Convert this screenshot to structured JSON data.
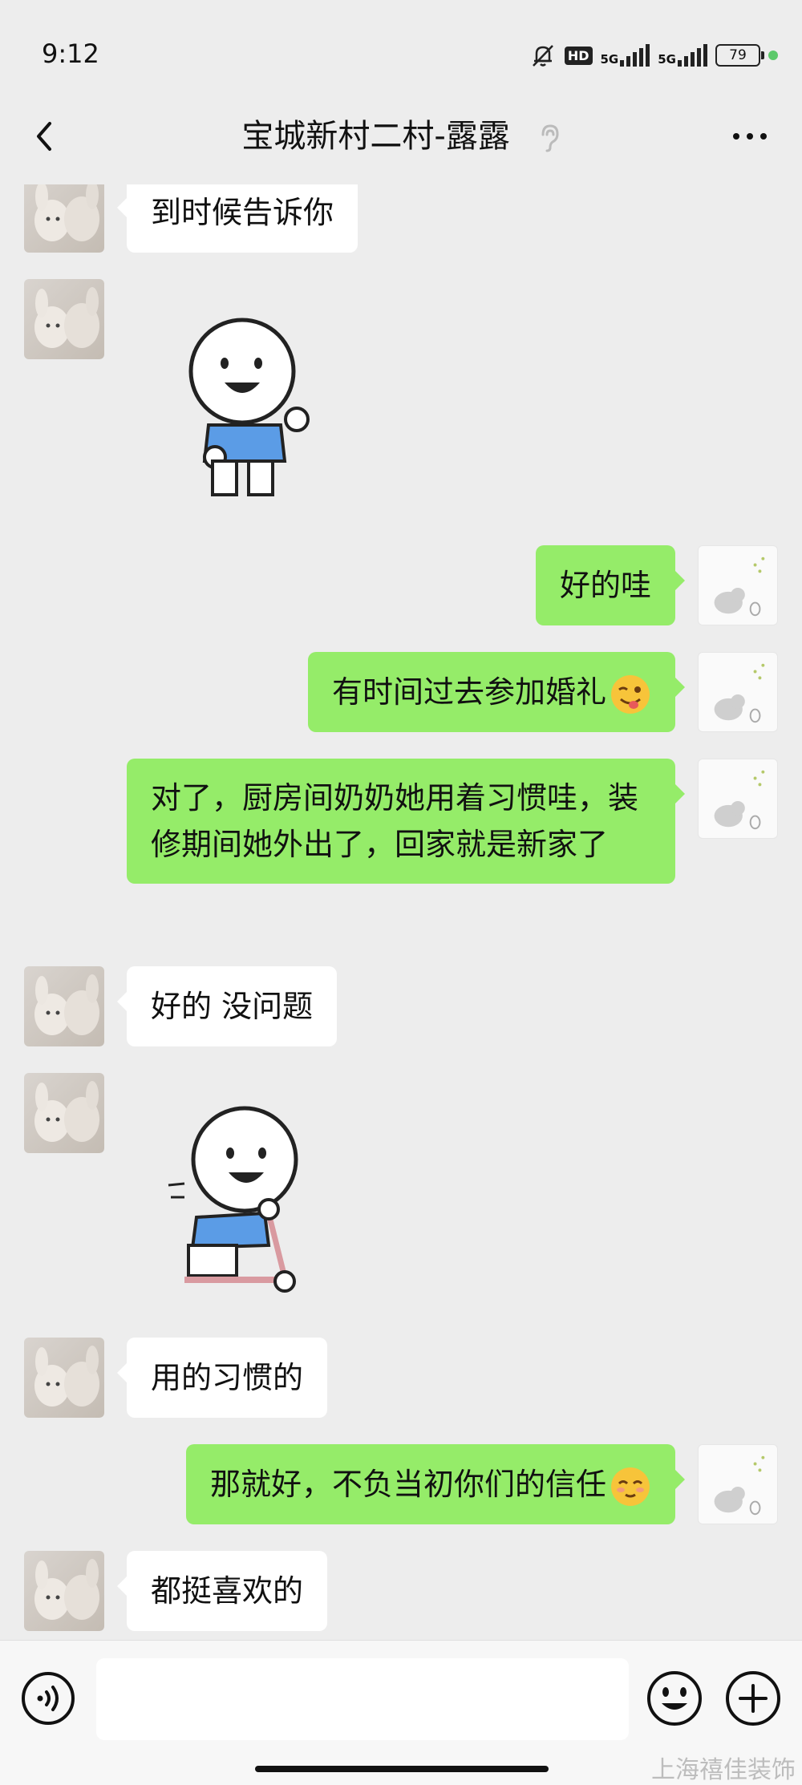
{
  "status_bar": {
    "time": "9:12",
    "hd_label": "HD",
    "network_a": "5G",
    "network_b": "5G",
    "battery": "79"
  },
  "header": {
    "title": "宝城新村二村-露露",
    "back_icon": "chevron-left-icon",
    "ear_icon": "ear-icon",
    "more_icon": "more-dots-icon"
  },
  "messages": [
    {
      "side": "left",
      "kind": "text",
      "text": "到时候告诉你"
    },
    {
      "side": "left",
      "kind": "sticker",
      "sticker": "waving-cartoon-sticker"
    },
    {
      "side": "right",
      "kind": "text",
      "text": "好的哇"
    },
    {
      "side": "right",
      "kind": "text",
      "text": "有时间过去参加婚礼",
      "emoji": "wink-tongue-emoji"
    },
    {
      "side": "right",
      "kind": "text",
      "text": "对了，厨房间奶奶她用着习惯哇，装修期间她外出了，回家就是新家了"
    },
    {
      "side": "left",
      "kind": "text",
      "text": "好的 没问题"
    },
    {
      "side": "left",
      "kind": "sticker",
      "sticker": "scooter-cartoon-sticker"
    },
    {
      "side": "left",
      "kind": "text",
      "text": "用的习惯的"
    },
    {
      "side": "right",
      "kind": "text",
      "text": "那就好，不负当初你们的信任",
      "emoji": "shy-smile-emoji"
    },
    {
      "side": "left",
      "kind": "text",
      "text": "都挺喜欢的"
    }
  ],
  "input_bar": {
    "voice_icon": "voice-icon",
    "emoji_icon": "smile-icon",
    "plus_icon": "plus-icon",
    "placeholder": ""
  },
  "watermark": "上海禧佳装饰",
  "colors": {
    "background": "#ededed",
    "sent_bubble": "#95ec69",
    "received_bubble": "#ffffff",
    "status_dot": "#5cc96a"
  }
}
